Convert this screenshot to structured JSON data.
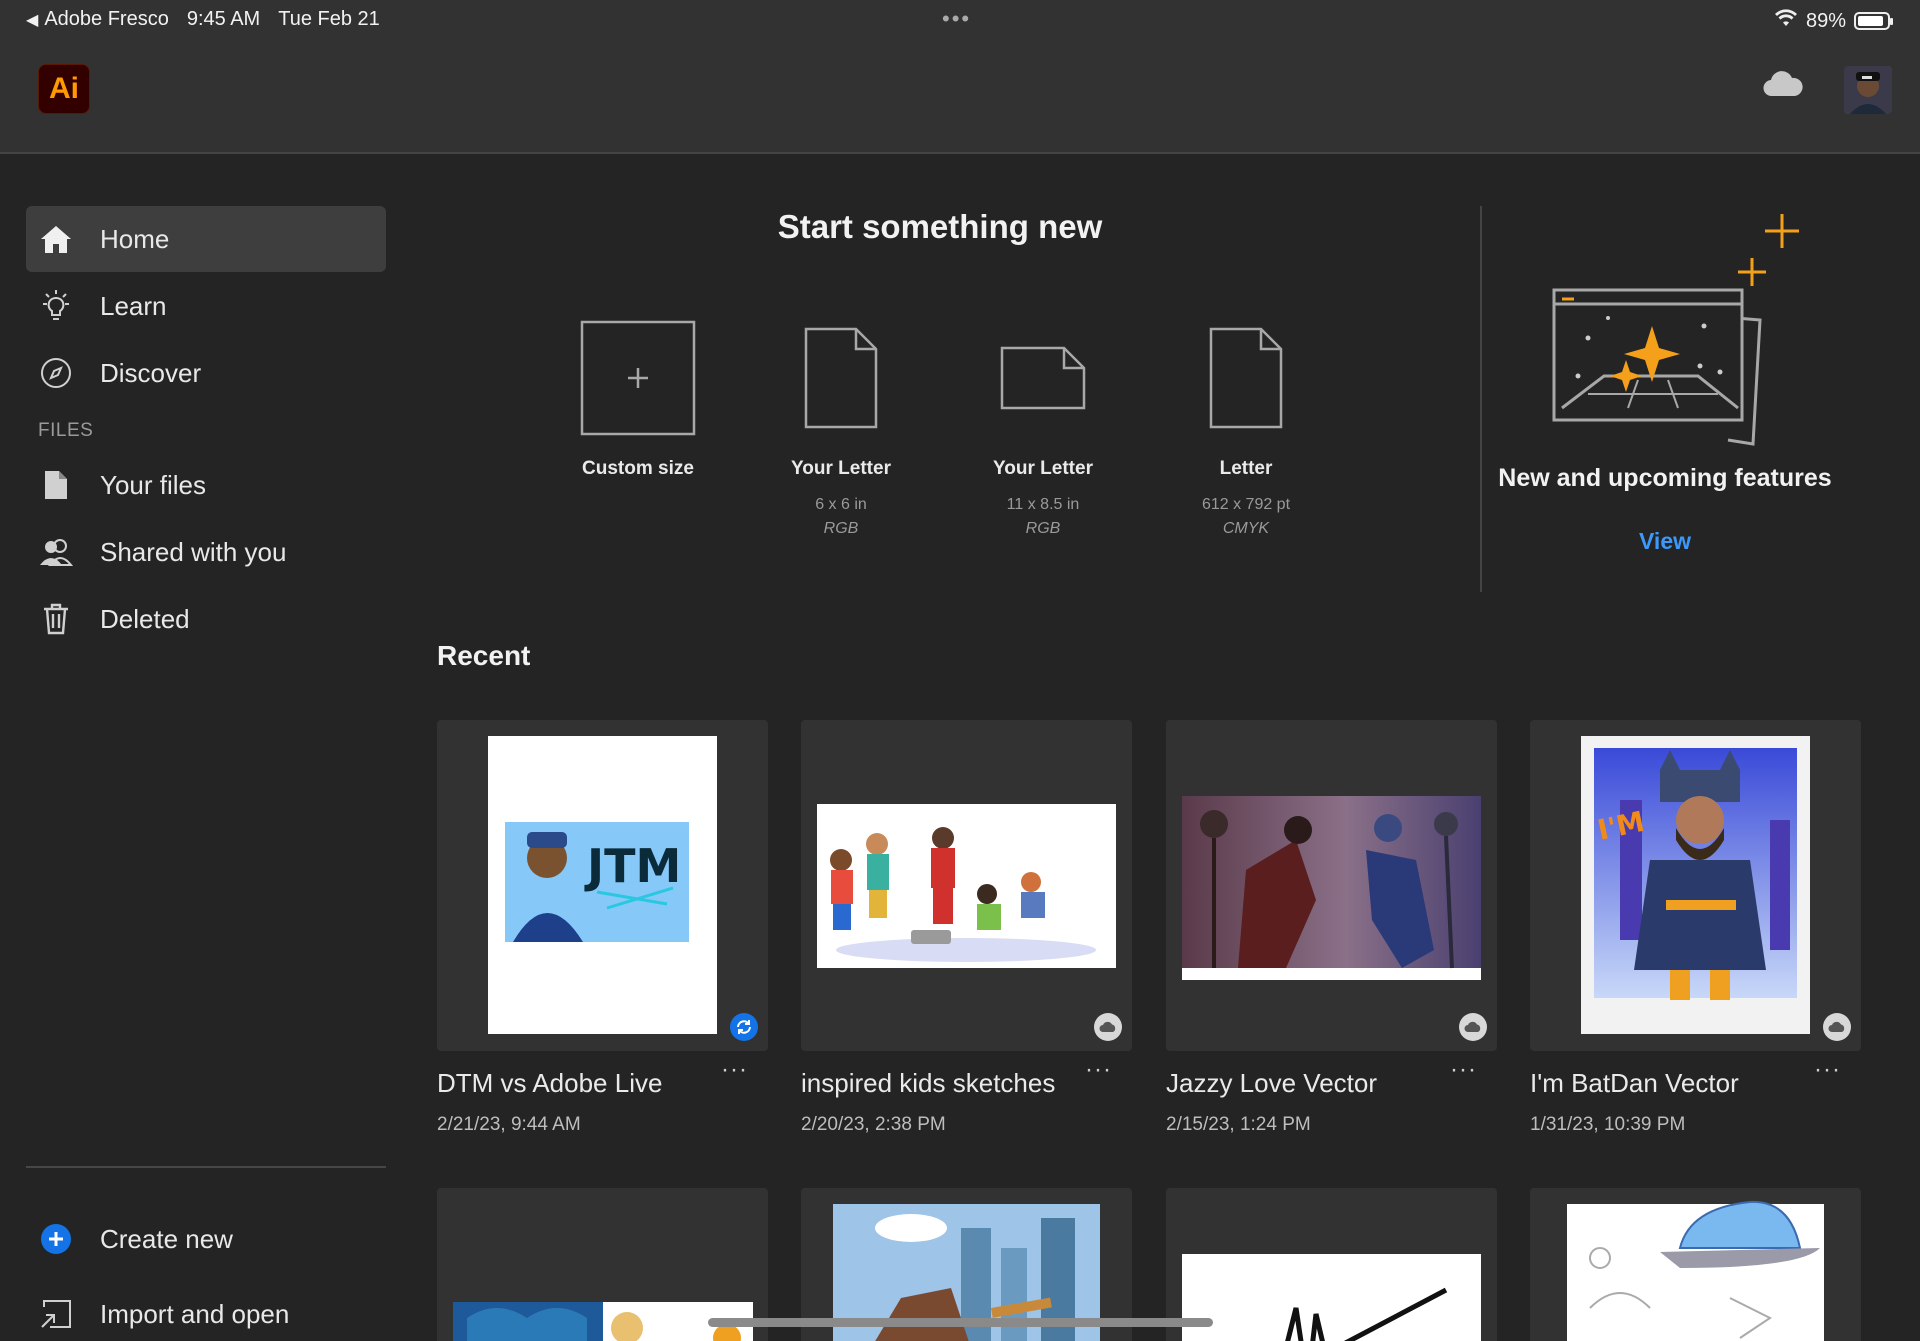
{
  "status_bar": {
    "back_app": "Adobe Fresco",
    "time": "9:45 AM",
    "date": "Tue Feb 21",
    "battery_percent": "89%",
    "battery_level": 0.89
  },
  "app": {
    "logo_text": "Ai",
    "logo_color": "#ff9a00"
  },
  "sidebar": {
    "items": [
      {
        "label": "Home",
        "icon": "home-icon",
        "active": true
      },
      {
        "label": "Learn",
        "icon": "lightbulb-icon"
      },
      {
        "label": "Discover",
        "icon": "compass-icon"
      }
    ],
    "files_heading": "FILES",
    "file_items": [
      {
        "label": "Your files",
        "icon": "file-icon"
      },
      {
        "label": "Shared with you",
        "icon": "shared-users-icon"
      },
      {
        "label": "Deleted",
        "icon": "trash-icon"
      }
    ],
    "bottom_items": [
      {
        "label": "Create new",
        "icon": "plus-circle-icon"
      },
      {
        "label": "Import and open",
        "icon": "import-icon"
      }
    ]
  },
  "start": {
    "title": "Start something new",
    "presets": [
      {
        "name": "Custom size",
        "dims": "",
        "mode": ""
      },
      {
        "name": "Your Letter",
        "dims": "6 x 6 in",
        "mode": "RGB"
      },
      {
        "name": "Your Letter",
        "dims": "11 x 8.5 in",
        "mode": "RGB"
      },
      {
        "name": "Letter",
        "dims": "612 x 792 pt",
        "mode": "CMYK"
      }
    ]
  },
  "features": {
    "title": "New and upcoming features",
    "view_label": "View"
  },
  "recent": {
    "title": "Recent",
    "items": [
      {
        "name": "DTM vs Adobe Live",
        "date": "2/21/23, 9:44 AM",
        "status": "syncing"
      },
      {
        "name": "inspired kids sketches",
        "date": "2/20/23, 2:38 PM",
        "status": "cloud"
      },
      {
        "name": "Jazzy Love Vector",
        "date": "2/15/23, 1:24 PM",
        "status": "cloud"
      },
      {
        "name": "I'm BatDan Vector",
        "date": "1/31/23, 10:39 PM",
        "status": "cloud"
      }
    ],
    "more_label": "···"
  },
  "colors": {
    "accent_blue": "#3b99fc",
    "feature_orange": "#f5a01a",
    "background": "#242424",
    "panel": "#323232"
  }
}
